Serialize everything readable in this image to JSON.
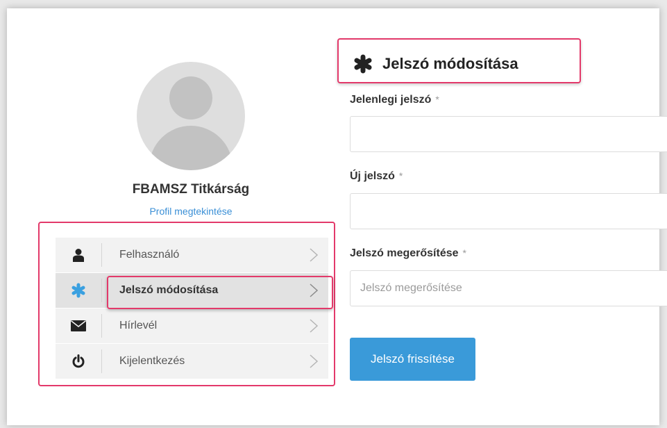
{
  "profile": {
    "name": "FBAMSZ Titkárság",
    "view_profile_link": "Profil megtekintése"
  },
  "menu": {
    "items": [
      {
        "label": "Felhasználó",
        "icon": "user-icon",
        "active": false
      },
      {
        "label": "Jelszó módosítása",
        "icon": "asterisk-icon",
        "active": true
      },
      {
        "label": "Hírlevél",
        "icon": "envelope-icon",
        "active": false
      },
      {
        "label": "Kijelentkezés",
        "icon": "power-icon",
        "active": false
      }
    ]
  },
  "form": {
    "title": "Jelszó módosítása",
    "title_icon": "asterisk-icon",
    "current_password": {
      "label": "Jelenlegi jelszó",
      "required_mark": "*",
      "value": "",
      "placeholder": ""
    },
    "new_password": {
      "label": "Új jelszó",
      "required_mark": "*",
      "value": "",
      "placeholder": ""
    },
    "confirm_password": {
      "label": "Jelszó megerősítése",
      "required_mark": "*",
      "value": "",
      "placeholder": "Jelszó megerősítése"
    },
    "submit_label": "Jelszó frissítése"
  },
  "colors": {
    "accent": "#3a9ad9",
    "highlight": "#e3396a",
    "link": "#3a8fd6"
  }
}
